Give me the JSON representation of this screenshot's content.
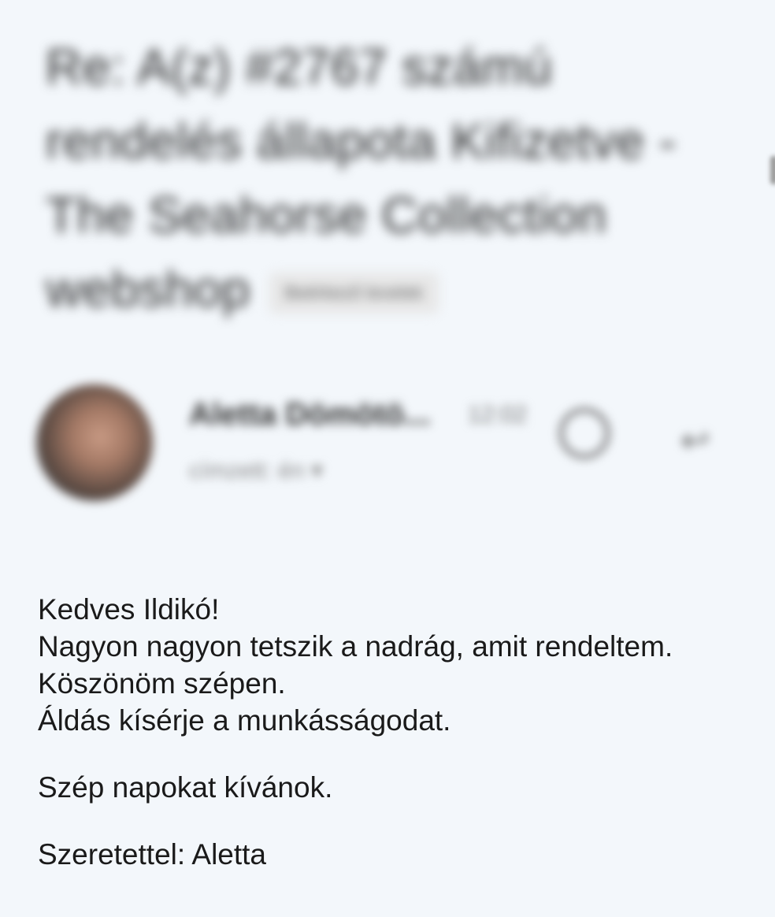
{
  "email": {
    "subject": "Re: A(z) #2767 számú rendelés állapota Kifizetve - The Seahorse Collection webshop",
    "label": "Beérkező levelek",
    "sender_name": "Aletta Dömötö...",
    "sender_time": "12:02",
    "recipient": "címzett: én ▾",
    "body_lines": [
      "Kedves Ildikó!",
      "Nagyon nagyon tetszik a nadrág, amit rendeltem.",
      "Köszönöm szépen.",
      "Áldás kísérje a munkásságodat."
    ],
    "closing_1": "Szép napokat kívánok.",
    "closing_2": "Szeretettel: Aletta"
  },
  "icons": {
    "emoji": "emoji-reaction-icon",
    "reply": "reply-icon"
  },
  "colors": {
    "background": "#f3f7fb",
    "text": "#1a1a1a"
  }
}
